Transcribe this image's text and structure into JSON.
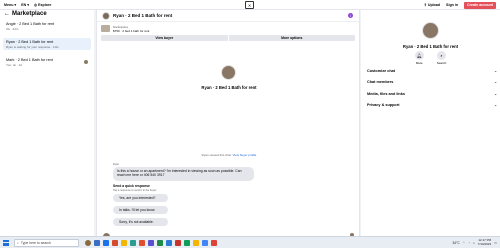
{
  "topbar": {
    "menu_label": "Menu",
    "lang_label": "EN",
    "explore_label": "Explore",
    "upload_label": "Upload",
    "signin_label": "Sign in",
    "create_label": "Create account"
  },
  "sidebar": {
    "title": "Marketplace",
    "items": [
      {
        "name": "Angie · 2 Bed 1 Bath for rent",
        "sub": "Ok · 24m"
      },
      {
        "name": "Ryan · 2 Bed 1 Bath for rent",
        "sub": "Ryan is waiting for your response · 10m"
      },
      {
        "name": "Mark · 2 Bed 1 Bath for rent",
        "sub": "You: ok · 1d"
      }
    ]
  },
  "conversation": {
    "title": "Ryan · 2 Bed 1 Bath for rent",
    "listing_label": "Marketplace",
    "listing_text": "$750 · 2 bed 1 bath for rent",
    "view_buyer_label": "View buyer",
    "more_options_label": "More options",
    "center_title": "Ryan · 2 Bed 1 Bath for rent",
    "viewed_text": "Ryan viewed this chat.",
    "viewed_link": "View buyer profile",
    "message_from": "Ryan",
    "message_text": "Is this a house or an apartment? I'm interested in viewing as soon as possible. Can reach me here or 406 540 3917",
    "quick_title": "Send a quick response",
    "quick_sub": "Tap a response to send it to the buyer.",
    "quick_replies": [
      "Yes, are you interested?",
      "In talks. I'll let you know.",
      "Sorry, it's not available."
    ]
  },
  "right_panel": {
    "title": "Ryan · 2 Bed 1 Bath for rent",
    "mute_label": "Mute",
    "search_label": "Search",
    "menu": [
      "Customize chat",
      "Chat members",
      "Media, files and links",
      "Privacy & support"
    ]
  },
  "taskbar": {
    "search_placeholder": "Type here to search",
    "weather": "34°C",
    "time": "12:17 PM",
    "date": "7/10/2023"
  }
}
